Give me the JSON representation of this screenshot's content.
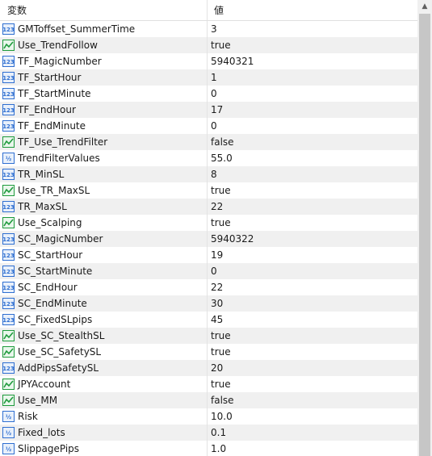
{
  "header": {
    "col_name": "変数",
    "col_value": "値"
  },
  "rows": [
    {
      "icon": "int-icon",
      "name": "GMToffset_SummerTime",
      "value": "3"
    },
    {
      "icon": "bool-icon",
      "name": "Use_TrendFollow",
      "value": "true"
    },
    {
      "icon": "int-icon",
      "name": "TF_MagicNumber",
      "value": "5940321"
    },
    {
      "icon": "int-icon",
      "name": "TF_StartHour",
      "value": "1"
    },
    {
      "icon": "int-icon",
      "name": "TF_StartMinute",
      "value": "0"
    },
    {
      "icon": "int-icon",
      "name": "TF_EndHour",
      "value": "17"
    },
    {
      "icon": "int-icon",
      "name": "TF_EndMinute",
      "value": "0"
    },
    {
      "icon": "bool-icon",
      "name": "TF_Use_TrendFilter",
      "value": "false"
    },
    {
      "icon": "double-icon",
      "name": "TrendFilterValues",
      "value": "55.0"
    },
    {
      "icon": "int-icon",
      "name": "TR_MinSL",
      "value": "8"
    },
    {
      "icon": "bool-icon",
      "name": "Use_TR_MaxSL",
      "value": "true"
    },
    {
      "icon": "int-icon",
      "name": "TR_MaxSL",
      "value": "22"
    },
    {
      "icon": "bool-icon",
      "name": "Use_Scalping",
      "value": "true"
    },
    {
      "icon": "int-icon",
      "name": "SC_MagicNumber",
      "value": "5940322"
    },
    {
      "icon": "int-icon",
      "name": "SC_StartHour",
      "value": "19"
    },
    {
      "icon": "int-icon",
      "name": "SC_StartMinute",
      "value": "0"
    },
    {
      "icon": "int-icon",
      "name": "SC_EndHour",
      "value": "22"
    },
    {
      "icon": "int-icon",
      "name": "SC_EndMinute",
      "value": "30"
    },
    {
      "icon": "int-icon",
      "name": "SC_FixedSLpips",
      "value": "45"
    },
    {
      "icon": "bool-icon",
      "name": "Use_SC_StealthSL",
      "value": "true"
    },
    {
      "icon": "bool-icon",
      "name": "Use_SC_SafetySL",
      "value": "true"
    },
    {
      "icon": "int-icon",
      "name": "AddPipsSafetySL",
      "value": "20"
    },
    {
      "icon": "bool-icon",
      "name": "JPYAccount",
      "value": "true"
    },
    {
      "icon": "bool-icon",
      "name": "Use_MM",
      "value": "false"
    },
    {
      "icon": "double-icon",
      "name": "Risk",
      "value": "10.0"
    },
    {
      "icon": "double-icon",
      "name": "Fixed_lots",
      "value": "0.1"
    },
    {
      "icon": "double-icon",
      "name": "SlippagePips",
      "value": "1.0"
    }
  ],
  "colors": {
    "alt_row": "#f0f0f0",
    "icon_blue": "#2f6fd1",
    "icon_green": "#1e9a3c"
  }
}
